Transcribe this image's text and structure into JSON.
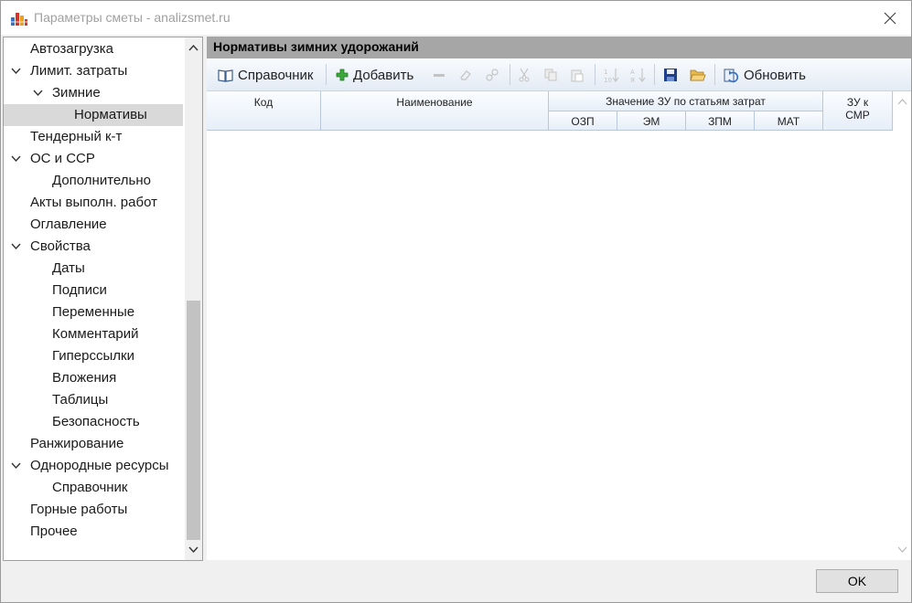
{
  "window": {
    "title": "Параметры сметы - analizsmet.ru"
  },
  "tree": {
    "items": [
      {
        "label": "Автозагрузка"
      },
      {
        "label": "Лимит. затраты"
      },
      {
        "label": "Зимние"
      },
      {
        "label": "Нормативы"
      },
      {
        "label": "Тендерный к-т"
      },
      {
        "label": "ОС и ССР"
      },
      {
        "label": "Дополнительно"
      },
      {
        "label": "Акты выполн. работ"
      },
      {
        "label": "Оглавление"
      },
      {
        "label": "Свойства"
      },
      {
        "label": "Даты"
      },
      {
        "label": "Подписи"
      },
      {
        "label": "Переменные"
      },
      {
        "label": "Комментарий"
      },
      {
        "label": "Гиперссылки"
      },
      {
        "label": "Вложения"
      },
      {
        "label": "Таблицы"
      },
      {
        "label": "Безопасность"
      },
      {
        "label": "Ранжирование"
      },
      {
        "label": "Однородные ресурсы"
      },
      {
        "label": "Справочник"
      },
      {
        "label": "Горные работы"
      },
      {
        "label": "Прочее"
      }
    ]
  },
  "panel": {
    "title": "Нормативы зимних удорожаний",
    "toolbar": {
      "reference": "Справочник",
      "add": "Добавить",
      "refresh": "Обновить"
    },
    "grid": {
      "col_code": "Код",
      "col_name": "Наименование",
      "col_group": "Значение ЗУ по статьям затрат",
      "sub_ozp": "ОЗП",
      "sub_em": "ЭМ",
      "sub_zpm": "ЗПМ",
      "sub_mat": "МАТ",
      "col_zu_line1": "ЗУ к",
      "col_zu_line2": "СМР"
    }
  },
  "footer": {
    "ok": "OK"
  }
}
